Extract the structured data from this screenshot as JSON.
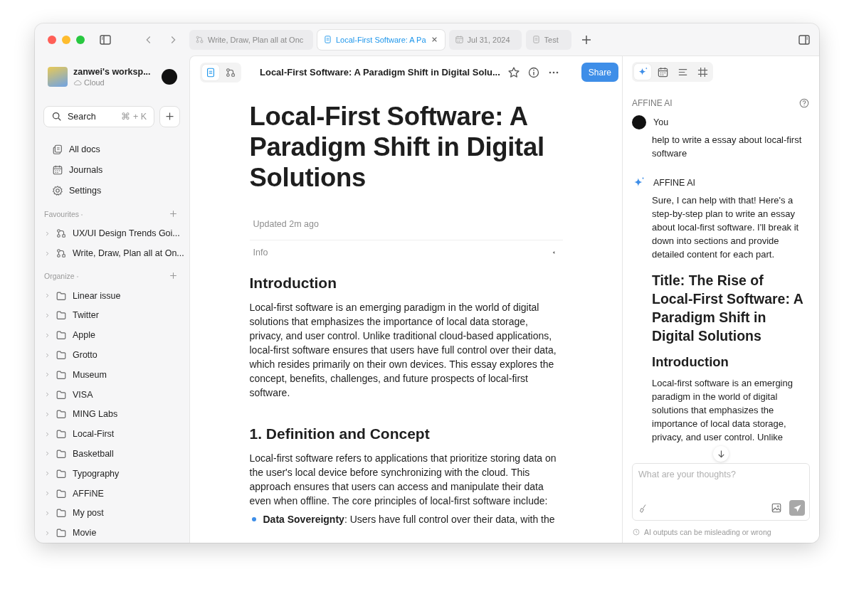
{
  "window": {
    "tabs": [
      {
        "label": "Write, Draw, Plan all at Onc",
        "selected": false
      },
      {
        "label": "Local-First Software: A Pa",
        "selected": true
      },
      {
        "label": "Jul 31, 2024",
        "selected": false
      },
      {
        "label": "Test",
        "selected": false
      }
    ]
  },
  "sidebar": {
    "workspace": {
      "name": "zanwei's worksp...",
      "status": "Cloud"
    },
    "search": {
      "label": "Search",
      "shortcut": "⌘ + K"
    },
    "nav": [
      {
        "label": "All docs"
      },
      {
        "label": "Journals"
      },
      {
        "label": "Settings"
      }
    ],
    "favourites": {
      "title": "Favourites",
      "items": [
        {
          "label": "UX/UI Design Trends Goi..."
        },
        {
          "label": "Write, Draw, Plan all at On..."
        }
      ]
    },
    "organize": {
      "title": "Organize",
      "items": [
        {
          "label": "Linear issue"
        },
        {
          "label": "Twitter"
        },
        {
          "label": "Apple"
        },
        {
          "label": "Grotto"
        },
        {
          "label": "Museum"
        },
        {
          "label": "VISA"
        },
        {
          "label": "MING Labs"
        },
        {
          "label": "Local-First"
        },
        {
          "label": "Basketball"
        },
        {
          "label": "Typography"
        },
        {
          "label": "AFFiNE"
        },
        {
          "label": "My post"
        },
        {
          "label": "Movie"
        }
      ]
    }
  },
  "editor": {
    "modes": [
      {
        "selected": true
      },
      {
        "selected": false
      }
    ],
    "doc_title": "Local-First Software: A Paradigm Shift in Digital Solu...",
    "share": "Share",
    "title": "Local-First Software: A Paradigm Shift in Digital Solutions",
    "updated": "Updated 2m ago",
    "info": "Info",
    "blocks": [
      {
        "kind": "h2",
        "text": "Introduction"
      },
      {
        "kind": "p",
        "text": "Local-first software is an emerging paradigm in the world of digital solutions that emphasizes the importance of local data storage, privacy, and user control. Unlike traditional cloud-based applications, local-first software ensures that users have full control over their data, which resides primarily on their own devices. This essay explores the concept, benefits, challenges, and future prospects of local-first software."
      },
      {
        "kind": "h2",
        "text": "1. Definition and Concept"
      },
      {
        "kind": "p",
        "text": "Local-first software refers to applications that prioritize storing data on the user's local device before synchronizing with the cloud. This approach ensures that users can access and manipulate their data even when offline. The core principles of local-first software include:"
      },
      {
        "kind": "bullet",
        "text": "**Data Sovereignty**: Users have full control over their data, with the"
      }
    ]
  },
  "chat": {
    "tools": [
      {
        "selected": true
      },
      {
        "selected": false
      },
      {
        "selected": false
      },
      {
        "selected": false
      }
    ],
    "header": "AFFINE AI",
    "messages": [
      {
        "kind": "user",
        "author": "You",
        "blocks": [
          {
            "kind": "p",
            "text": "help to write a essay about local-first software"
          }
        ]
      },
      {
        "kind": "ai",
        "author": "AFFINE AI",
        "blocks": [
          {
            "kind": "p",
            "text": "Sure, I can help with that! Here's a step-by-step plan to write an essay about local-first software. I'll break it down into sections and provide detailed content for each part."
          },
          {
            "kind": "h1",
            "text": "Title: The Rise of Local-First Software: A Paradigm Shift in Digital Solutions"
          },
          {
            "kind": "h2",
            "text": "Introduction"
          },
          {
            "kind": "p",
            "text": "Local-first software is an emerging paradigm in the world of digital solutions that emphasizes the importance of local data storage, privacy, and user control. Unlike"
          }
        ]
      }
    ],
    "input": {
      "placeholder": "What are your thoughts?"
    },
    "note": "AI outputs can be misleading or wrong"
  }
}
